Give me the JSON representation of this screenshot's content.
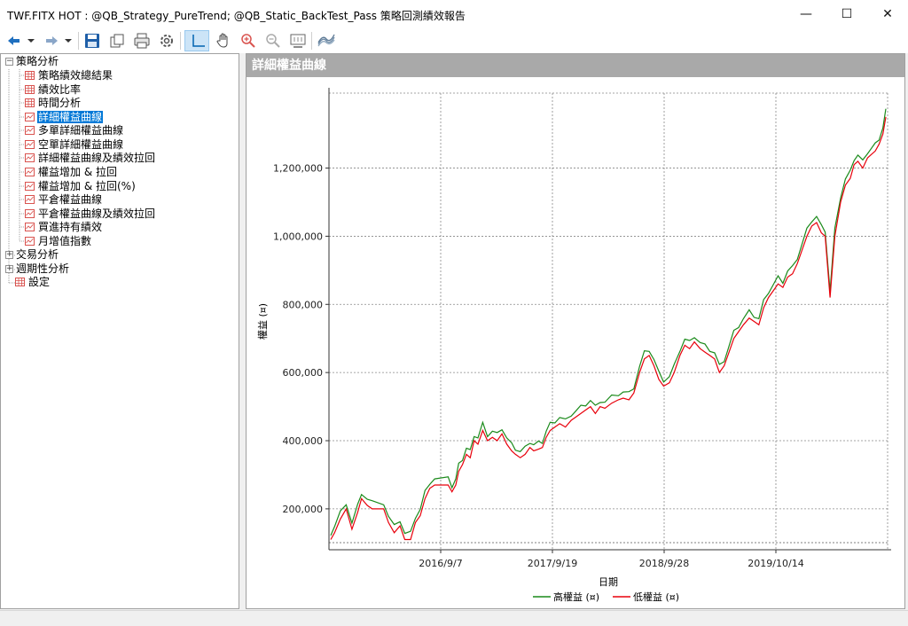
{
  "window": {
    "title": "TWF.FITX HOT : @QB_Strategy_PureTrend; @QB_Static_BackTest_Pass 策略回測績效報告",
    "minimize_glyph": "—",
    "maximize_glyph": "☐",
    "close_glyph": "✕"
  },
  "toolbar": {
    "icons": [
      "back-icon",
      "dropdown-icon",
      "forward-icon",
      "dropdown-icon",
      "save-icon",
      "copy-icon",
      "print-icon",
      "settings-icon",
      "crosshair-icon",
      "pan-icon",
      "zoom-in-icon",
      "zoom-out-icon",
      "fit-icon",
      "chart-style-icon"
    ],
    "accent": "#0063b1"
  },
  "tree": {
    "groups": [
      {
        "label": "策略分析",
        "expanded": true,
        "expander": "−",
        "items": [
          {
            "label": "策略績效總結果",
            "icon": "table-icon"
          },
          {
            "label": "績效比率",
            "icon": "table-icon"
          },
          {
            "label": "時間分析",
            "icon": "table-icon"
          },
          {
            "label": "詳細權益曲線",
            "icon": "chart-icon",
            "selected": true
          },
          {
            "label": "多單詳細權益曲線",
            "icon": "chart-icon"
          },
          {
            "label": "空單詳細權益曲線",
            "icon": "chart-icon"
          },
          {
            "label": "詳細權益曲線及績效拉回",
            "icon": "chart-icon"
          },
          {
            "label": "權益增加 & 拉回",
            "icon": "chart-icon"
          },
          {
            "label": "權益增加 & 拉回(%)",
            "icon": "chart-icon"
          },
          {
            "label": "平倉權益曲線",
            "icon": "chart-icon"
          },
          {
            "label": "平倉權益曲線及績效拉回",
            "icon": "chart-icon"
          },
          {
            "label": "買進持有績效",
            "icon": "chart-icon"
          },
          {
            "label": "月增值指數",
            "icon": "chart-icon"
          }
        ]
      },
      {
        "label": "交易分析",
        "expanded": false,
        "expander": "+"
      },
      {
        "label": "週期性分析",
        "expanded": false,
        "expander": "+"
      }
    ],
    "settings": {
      "label": "設定",
      "icon": "table-icon"
    }
  },
  "main": {
    "header": "詳細權益曲線"
  },
  "chart_data": {
    "type": "line",
    "xlabel": "日期",
    "ylabel": "權益 (¤)",
    "x_ticks": [
      "2016/9/7",
      "2017/9/19",
      "2018/9/28",
      "2019/10/14"
    ],
    "y_ticks": [
      "200,000",
      "400,000",
      "600,000",
      "800,000",
      "1,000,000",
      "1,200,000"
    ],
    "ylim": [
      80000,
      1420000
    ],
    "grid": true,
    "legend_position": "bottom",
    "series": [
      {
        "name": "高權益 (¤)",
        "color": "#1a8a1a"
      },
      {
        "name": "低權益 (¤)",
        "color": "#e8000b"
      }
    ],
    "points": [
      [
        0,
        110000
      ],
      [
        0.4,
        130000
      ],
      [
        1,
        170000
      ],
      [
        1.6,
        200000
      ],
      [
        2.2,
        140000
      ],
      [
        2.8,
        190000
      ],
      [
        3.2,
        230000
      ],
      [
        3.8,
        210000
      ],
      [
        4.3,
        200000
      ],
      [
        5.5,
        200000
      ],
      [
        6,
        160000
      ],
      [
        6.6,
        130000
      ],
      [
        7.2,
        150000
      ],
      [
        7.7,
        110000
      ],
      [
        8.3,
        110000
      ],
      [
        8.8,
        160000
      ],
      [
        9.3,
        180000
      ],
      [
        9.8,
        230000
      ],
      [
        10.3,
        260000
      ],
      [
        10.8,
        270000
      ],
      [
        12.2,
        270000
      ],
      [
        12.6,
        250000
      ],
      [
        13,
        270000
      ],
      [
        13.3,
        310000
      ],
      [
        13.7,
        330000
      ],
      [
        14.1,
        360000
      ],
      [
        14.5,
        350000
      ],
      [
        14.9,
        400000
      ],
      [
        15.3,
        390000
      ],
      [
        15.8,
        430000
      ],
      [
        16.3,
        400000
      ],
      [
        16.8,
        410000
      ],
      [
        17.3,
        400000
      ],
      [
        17.8,
        420000
      ],
      [
        18.3,
        390000
      ],
      [
        18.8,
        370000
      ],
      [
        19.2,
        360000
      ],
      [
        19.7,
        350000
      ],
      [
        20.2,
        360000
      ],
      [
        20.7,
        380000
      ],
      [
        21.1,
        370000
      ],
      [
        21.6,
        375000
      ],
      [
        22,
        380000
      ],
      [
        22.4,
        410000
      ],
      [
        22.8,
        430000
      ],
      [
        23.3,
        440000
      ],
      [
        23.8,
        450000
      ],
      [
        24.4,
        440000
      ],
      [
        25,
        460000
      ],
      [
        25.5,
        470000
      ],
      [
        26,
        480000
      ],
      [
        26.5,
        490000
      ],
      [
        27,
        500000
      ],
      [
        27.5,
        480000
      ],
      [
        28,
        500000
      ],
      [
        28.5,
        495000
      ],
      [
        29.2,
        510000
      ],
      [
        29.9,
        520000
      ],
      [
        30.4,
        525000
      ],
      [
        31,
        520000
      ],
      [
        31.5,
        540000
      ],
      [
        32.1,
        600000
      ],
      [
        32.6,
        640000
      ],
      [
        33.1,
        650000
      ],
      [
        33.6,
        620000
      ],
      [
        34.1,
        580000
      ],
      [
        34.6,
        560000
      ],
      [
        35.2,
        570000
      ],
      [
        35.7,
        600000
      ],
      [
        36.3,
        650000
      ],
      [
        36.8,
        680000
      ],
      [
        37.3,
        670000
      ],
      [
        37.8,
        690000
      ],
      [
        38.4,
        670000
      ],
      [
        38.9,
        660000
      ],
      [
        39.4,
        650000
      ],
      [
        39.9,
        640000
      ],
      [
        40.4,
        600000
      ],
      [
        40.9,
        620000
      ],
      [
        41.4,
        660000
      ],
      [
        41.9,
        700000
      ],
      [
        42.4,
        720000
      ],
      [
        42.9,
        740000
      ],
      [
        43.5,
        760000
      ],
      [
        44,
        750000
      ],
      [
        44.5,
        740000
      ],
      [
        45,
        790000
      ],
      [
        45.5,
        820000
      ],
      [
        46,
        840000
      ],
      [
        46.5,
        860000
      ],
      [
        47,
        850000
      ],
      [
        47.5,
        880000
      ],
      [
        48,
        890000
      ],
      [
        48.5,
        920000
      ],
      [
        49,
        960000
      ],
      [
        49.5,
        1000000
      ],
      [
        50,
        1030000
      ],
      [
        50.5,
        1040000
      ],
      [
        51,
        1010000
      ],
      [
        51.4,
        1000000
      ],
      [
        51.9,
        820000
      ],
      [
        52.4,
        1000000
      ],
      [
        53,
        1100000
      ],
      [
        53.5,
        1150000
      ],
      [
        54,
        1170000
      ],
      [
        54.4,
        1210000
      ],
      [
        54.8,
        1220000
      ],
      [
        55.3,
        1200000
      ],
      [
        55.8,
        1230000
      ],
      [
        56.2,
        1240000
      ],
      [
        56.6,
        1250000
      ],
      [
        57,
        1270000
      ],
      [
        57.4,
        1300000
      ],
      [
        57.7,
        1350000
      ]
    ]
  },
  "colors": {
    "selection": "#0078d7",
    "header_bar": "#a9a9a9",
    "high_line": "#1a8a1a",
    "low_line": "#e8000b"
  }
}
